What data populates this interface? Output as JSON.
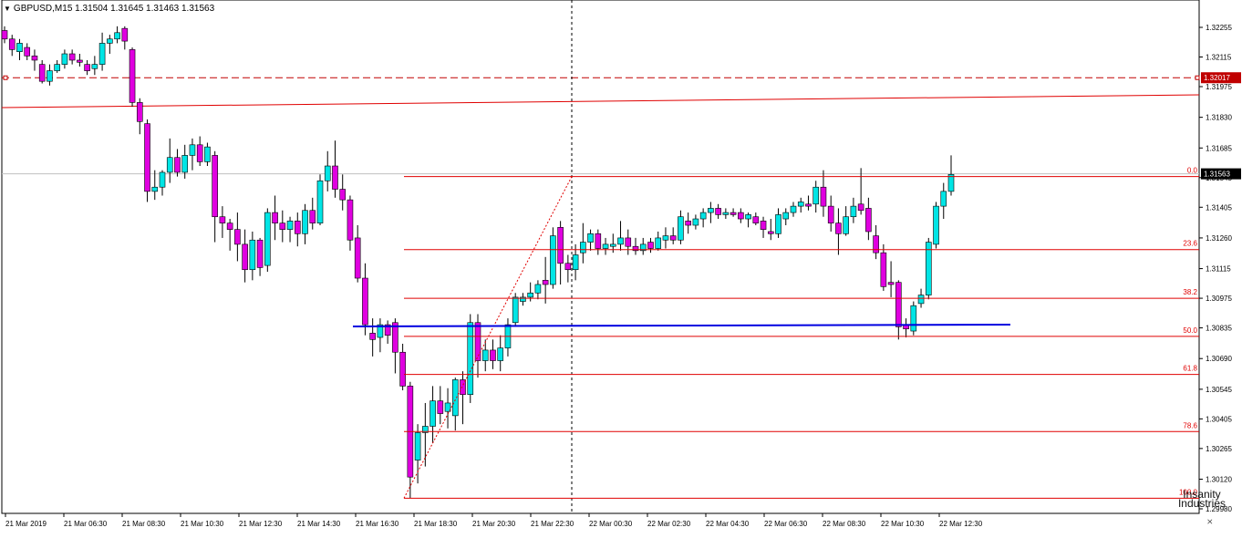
{
  "chart_data": {
    "type": "candlestick",
    "symbol": "GBPUSD,M15",
    "ohlc_header": [
      "1.31504",
      "1.31645",
      "1.31463",
      "1.31563"
    ],
    "y_ticks": [
      "1.32255",
      "1.32115",
      "1.31975",
      "1.31830",
      "1.31685",
      "1.31545",
      "1.31405",
      "1.31260",
      "1.31115",
      "1.30975",
      "1.30835",
      "1.30690",
      "1.30545",
      "1.30405",
      "1.30265",
      "1.30120",
      "1.29980"
    ],
    "x_ticks": [
      "21 Mar 2019",
      "21 Mar 06:30",
      "21 Mar 08:30",
      "21 Mar 10:30",
      "21 Mar 12:30",
      "21 Mar 14:30",
      "21 Mar 16:30",
      "21 Mar 18:30",
      "21 Mar 20:30",
      "21 Mar 22:30",
      "22 Mar 00:30",
      "22 Mar 02:30",
      "22 Mar 04:30",
      "22 Mar 06:30",
      "22 Mar 08:30",
      "22 Mar 10:30",
      "22 Mar 12:30"
    ],
    "price_labels": {
      "alert": "1.32017",
      "current": "1.31563"
    },
    "fib_levels": [
      {
        "label": "0.0",
        "price": 1.3155
      },
      {
        "label": "23.6",
        "price": 1.31205
      },
      {
        "label": "38.2",
        "price": 1.30975
      },
      {
        "label": "50.0",
        "price": 1.30795
      },
      {
        "label": "61.8",
        "price": 1.30615
      },
      {
        "label": "78.6",
        "price": 1.30345
      },
      {
        "label": "100.0",
        "price": 1.3003
      }
    ],
    "candles": [
      [
        1.3224,
        1.3226,
        1.3218,
        1.322
      ],
      [
        1.322,
        1.3222,
        1.3212,
        1.3215
      ],
      [
        1.3214,
        1.322,
        1.321,
        1.3218
      ],
      [
        1.3216,
        1.3218,
        1.321,
        1.3212
      ],
      [
        1.3212,
        1.3215,
        1.3205,
        1.321
      ],
      [
        1.3208,
        1.321,
        1.3199,
        1.32
      ],
      [
        1.32,
        1.3208,
        1.3198,
        1.3205
      ],
      [
        1.3205,
        1.321,
        1.3204,
        1.3208
      ],
      [
        1.3208,
        1.3215,
        1.3206,
        1.3213
      ],
      [
        1.3213,
        1.3215,
        1.3208,
        1.321
      ],
      [
        1.321,
        1.3213,
        1.3207,
        1.3209
      ],
      [
        1.3208,
        1.321,
        1.3203,
        1.3205
      ],
      [
        1.3206,
        1.3212,
        1.3203,
        1.3208
      ],
      [
        1.3208,
        1.3223,
        1.3205,
        1.3218
      ],
      [
        1.3218,
        1.3222,
        1.3213,
        1.322
      ],
      [
        1.322,
        1.3226,
        1.3218,
        1.3223
      ],
      [
        1.3225,
        1.3226,
        1.3215,
        1.3219
      ],
      [
        1.3215,
        1.3216,
        1.3188,
        1.319
      ],
      [
        1.319,
        1.3192,
        1.3175,
        1.3181
      ],
      [
        1.318,
        1.3182,
        1.3143,
        1.3148
      ],
      [
        1.3148,
        1.3158,
        1.3144,
        1.315
      ],
      [
        1.315,
        1.3158,
        1.3146,
        1.3157
      ],
      [
        1.3157,
        1.3173,
        1.3152,
        1.3164
      ],
      [
        1.3164,
        1.3168,
        1.3155,
        1.3157
      ],
      [
        1.3157,
        1.317,
        1.3154,
        1.3165
      ],
      [
        1.3165,
        1.3173,
        1.3158,
        1.317
      ],
      [
        1.317,
        1.3174,
        1.316,
        1.3162
      ],
      [
        1.3162,
        1.3171,
        1.316,
        1.3169
      ],
      [
        1.3165,
        1.3167,
        1.3124,
        1.3136
      ],
      [
        1.3136,
        1.3141,
        1.3126,
        1.3133
      ],
      [
        1.3133,
        1.3135,
        1.312,
        1.313
      ],
      [
        1.313,
        1.3138,
        1.3115,
        1.3123
      ],
      [
        1.3123,
        1.313,
        1.3105,
        1.3111
      ],
      [
        1.3111,
        1.3129,
        1.3106,
        1.3125
      ],
      [
        1.3125,
        1.3126,
        1.3108,
        1.3112
      ],
      [
        1.3113,
        1.314,
        1.311,
        1.3138
      ],
      [
        1.3138,
        1.3146,
        1.3125,
        1.3133
      ],
      [
        1.3133,
        1.3139,
        1.3124,
        1.313
      ],
      [
        1.313,
        1.3136,
        1.3124,
        1.3134
      ],
      [
        1.3134,
        1.3138,
        1.3122,
        1.3128
      ],
      [
        1.3128,
        1.3142,
        1.3123,
        1.3139
      ],
      [
        1.3139,
        1.3145,
        1.313,
        1.3133
      ],
      [
        1.3133,
        1.3156,
        1.3132,
        1.3153
      ],
      [
        1.3153,
        1.3167,
        1.3148,
        1.316
      ],
      [
        1.316,
        1.3172,
        1.3145,
        1.3149
      ],
      [
        1.3149,
        1.3156,
        1.3139,
        1.3144
      ],
      [
        1.3144,
        1.3146,
        1.312,
        1.3125
      ],
      [
        1.3126,
        1.3132,
        1.3105,
        1.3107
      ],
      [
        1.3107,
        1.3114,
        1.308,
        1.3085
      ],
      [
        1.3081,
        1.3088,
        1.307,
        1.3078
      ],
      [
        1.3079,
        1.3088,
        1.3072,
        1.3085
      ],
      [
        1.3085,
        1.3087,
        1.3076,
        1.308
      ],
      [
        1.3086,
        1.3088,
        1.3062,
        1.3072
      ],
      [
        1.3072,
        1.3076,
        1.3054,
        1.3056
      ],
      [
        1.3056,
        1.3058,
        1.3003,
        1.3013
      ],
      [
        1.3021,
        1.3038,
        1.301,
        1.3034
      ],
      [
        1.3034,
        1.3048,
        1.3018,
        1.3037
      ],
      [
        1.3037,
        1.3056,
        1.3029,
        1.3049
      ],
      [
        1.3049,
        1.3056,
        1.3038,
        1.3043
      ],
      [
        1.3044,
        1.3055,
        1.3036,
        1.3048
      ],
      [
        1.3042,
        1.306,
        1.3035,
        1.3059
      ],
      [
        1.3059,
        1.3063,
        1.3038,
        1.3052
      ],
      [
        1.3052,
        1.309,
        1.3048,
        1.3086
      ],
      [
        1.3086,
        1.309,
        1.306,
        1.3068
      ],
      [
        1.3068,
        1.3078,
        1.3063,
        1.3073
      ],
      [
        1.3073,
        1.3078,
        1.3064,
        1.3068
      ],
      [
        1.3068,
        1.308,
        1.3063,
        1.3074
      ],
      [
        1.3074,
        1.3088,
        1.307,
        1.3085
      ],
      [
        1.3086,
        1.31,
        1.3084,
        1.3098
      ],
      [
        1.3096,
        1.31,
        1.3094,
        1.3098
      ],
      [
        1.3098,
        1.3105,
        1.3096,
        1.31
      ],
      [
        1.31,
        1.3106,
        1.3097,
        1.3104
      ],
      [
        1.3106,
        1.3117,
        1.3095,
        1.3104
      ],
      [
        1.3104,
        1.3131,
        1.3102,
        1.3127
      ],
      [
        1.3131,
        1.3134,
        1.3104,
        1.3114
      ],
      [
        1.3114,
        1.3118,
        1.3105,
        1.3111
      ],
      [
        1.3111,
        1.3123,
        1.3106,
        1.3118
      ],
      [
        1.3119,
        1.3133,
        1.3114,
        1.3124
      ],
      [
        1.3124,
        1.313,
        1.312,
        1.3128
      ],
      [
        1.3128,
        1.313,
        1.3118,
        1.3121
      ],
      [
        1.3121,
        1.3126,
        1.3118,
        1.3123
      ],
      [
        1.3122,
        1.3128,
        1.3119,
        1.3123
      ],
      [
        1.3123,
        1.3134,
        1.312,
        1.3126
      ],
      [
        1.3126,
        1.313,
        1.3118,
        1.3122
      ],
      [
        1.3122,
        1.3126,
        1.3118,
        1.312
      ],
      [
        1.312,
        1.3126,
        1.3118,
        1.3123
      ],
      [
        1.3124,
        1.3126,
        1.3119,
        1.3121
      ],
      [
        1.3121,
        1.3129,
        1.312,
        1.3126
      ],
      [
        1.3125,
        1.3131,
        1.3121,
        1.3127
      ],
      [
        1.3127,
        1.3131,
        1.3123,
        1.3125
      ],
      [
        1.3125,
        1.3139,
        1.3123,
        1.3136
      ],
      [
        1.3134,
        1.3138,
        1.3128,
        1.3132
      ],
      [
        1.3132,
        1.3137,
        1.313,
        1.3135
      ],
      [
        1.3135,
        1.314,
        1.3131,
        1.3138
      ],
      [
        1.3138,
        1.3143,
        1.3133,
        1.314
      ],
      [
        1.314,
        1.3142,
        1.3135,
        1.3137
      ],
      [
        1.3137,
        1.314,
        1.3135,
        1.3138
      ],
      [
        1.3138,
        1.314,
        1.3136,
        1.3137
      ],
      [
        1.3138,
        1.314,
        1.3133,
        1.3135
      ],
      [
        1.3135,
        1.3138,
        1.3131,
        1.3137
      ],
      [
        1.3136,
        1.3138,
        1.3132,
        1.3133
      ],
      [
        1.3134,
        1.3136,
        1.3126,
        1.313
      ],
      [
        1.3129,
        1.3135,
        1.3125,
        1.3128
      ],
      [
        1.3128,
        1.314,
        1.3126,
        1.3137
      ],
      [
        1.3135,
        1.314,
        1.3132,
        1.3138
      ],
      [
        1.3138,
        1.3143,
        1.3136,
        1.3141
      ],
      [
        1.3141,
        1.3145,
        1.3138,
        1.3143
      ],
      [
        1.3142,
        1.3146,
        1.3139,
        1.3141
      ],
      [
        1.3142,
        1.3153,
        1.3138,
        1.315
      ],
      [
        1.315,
        1.3158,
        1.3136,
        1.3141
      ],
      [
        1.3141,
        1.3146,
        1.3129,
        1.3133
      ],
      [
        1.3133,
        1.314,
        1.3118,
        1.3128
      ],
      [
        1.3128,
        1.3141,
        1.3127,
        1.3136
      ],
      [
        1.3136,
        1.3145,
        1.3133,
        1.3141
      ],
      [
        1.3142,
        1.3159,
        1.3137,
        1.3139
      ],
      [
        1.314,
        1.3145,
        1.3125,
        1.3129
      ],
      [
        1.3127,
        1.3132,
        1.3116,
        1.3119
      ],
      [
        1.3119,
        1.3123,
        1.3101,
        1.3103
      ],
      [
        1.3105,
        1.3115,
        1.3098,
        1.3104
      ],
      [
        1.3105,
        1.3106,
        1.3078,
        1.3084
      ],
      [
        1.3085,
        1.3088,
        1.3079,
        1.3083
      ],
      [
        1.3082,
        1.3096,
        1.308,
        1.3094
      ],
      [
        1.3095,
        1.3102,
        1.3093,
        1.3099
      ],
      [
        1.3099,
        1.3126,
        1.3097,
        1.3124
      ],
      [
        1.3123,
        1.3143,
        1.3121,
        1.3141
      ],
      [
        1.3141,
        1.3152,
        1.3135,
        1.3148
      ],
      [
        1.3148,
        1.3165,
        1.3146,
        1.3156
      ]
    ]
  },
  "logo_text": [
    "Insanity",
    "Industries"
  ]
}
